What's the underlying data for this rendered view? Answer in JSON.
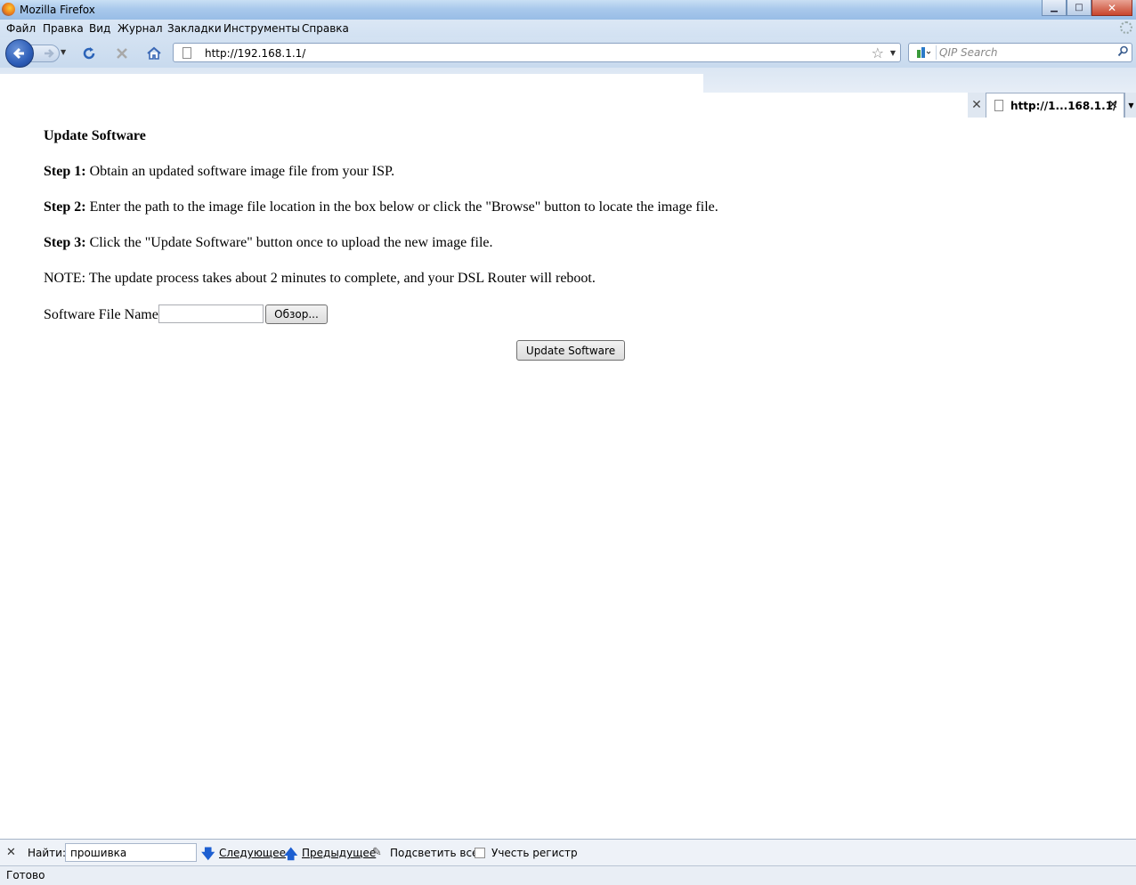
{
  "window": {
    "title": "Mozilla Firefox",
    "minimize": "▁",
    "maximize": "□",
    "close": "✕"
  },
  "menu": {
    "items": [
      "Файл",
      "Правка",
      "Вид",
      "Журнал",
      "Закладки",
      "Инструменты",
      "Справка"
    ]
  },
  "toolbar": {
    "back_icon": "back-arrow-icon",
    "forward_icon": "forward-arrow-icon",
    "reload_icon": "reload-icon",
    "stop_icon": "stop-icon",
    "home_icon": "home-icon",
    "url": "http://192.168.1.1/",
    "search_placeholder": "QIP Search"
  },
  "tabs": {
    "active_label": "http://1...168.1.1/"
  },
  "page": {
    "heading": "Update Software",
    "step1_label": "Step 1:",
    "step1_text": " Obtain an updated software image file from your ISP.",
    "step2_label": "Step 2:",
    "step2_text": " Enter the path to the image file location in the box below or click the \"Browse\" button to locate the image file.",
    "step3_label": "Step 3:",
    "step3_text": " Click the \"Update Software\" button once to upload the new image file.",
    "note": "NOTE: The update process takes about 2 minutes to complete, and your DSL Router will reboot.",
    "file_label": "Software File Name:",
    "browse_button": "Обзор...",
    "update_button": "Update Software"
  },
  "findbar": {
    "label": "Найти:",
    "query": "прошивка",
    "next": "Следующее",
    "previous": "Предыдущее",
    "highlight_all": "Подсветить все",
    "match_case": "Учесть регистр"
  },
  "status": {
    "text": "Готово"
  },
  "colors": {
    "chrome_blue": "#c8daee",
    "back_button": "#2d5db7",
    "find_arrow": "#1d5fd1"
  }
}
